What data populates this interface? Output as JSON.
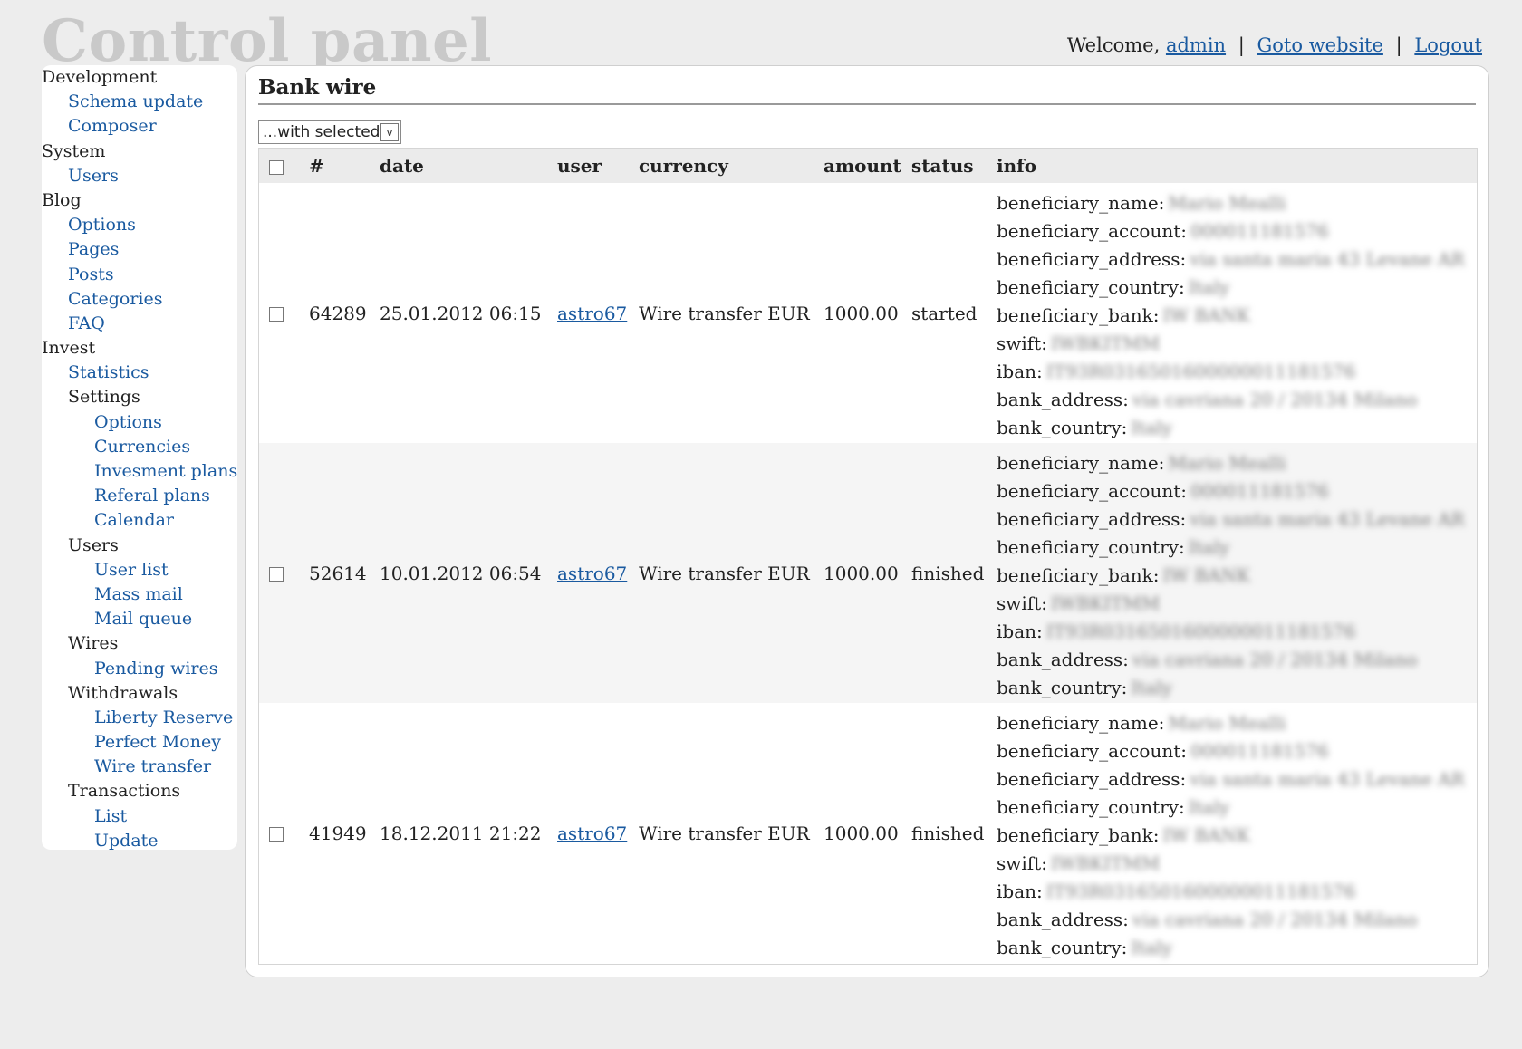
{
  "header": {
    "brand": "Control panel",
    "welcome": "Welcome,",
    "user_link": "admin",
    "goto_website": "Goto website",
    "logout": "Logout",
    "separator": "|"
  },
  "sidebar": {
    "groups": [
      {
        "label": "Development",
        "items": [
          {
            "label": "Schema update"
          },
          {
            "label": "Composer"
          }
        ]
      },
      {
        "label": "System",
        "items": [
          {
            "label": "Users"
          }
        ]
      },
      {
        "label": "Blog",
        "items": [
          {
            "label": "Options"
          },
          {
            "label": "Pages"
          },
          {
            "label": "Posts"
          },
          {
            "label": "Categories"
          },
          {
            "label": "FAQ"
          }
        ]
      },
      {
        "label": "Invest",
        "items": [
          {
            "label": "Statistics"
          }
        ],
        "subgroups": [
          {
            "label": "Settings",
            "items": [
              {
                "label": "Options"
              },
              {
                "label": "Currencies"
              },
              {
                "label": "Invesment plans"
              },
              {
                "label": "Referal plans"
              },
              {
                "label": "Calendar"
              }
            ]
          },
          {
            "label": "Users",
            "items": [
              {
                "label": "User list"
              },
              {
                "label": "Mass mail"
              },
              {
                "label": "Mail queue"
              }
            ]
          },
          {
            "label": "Wires",
            "items": [
              {
                "label": "Pending wires"
              }
            ]
          },
          {
            "label": "Withdrawals",
            "items": [
              {
                "label": "Liberty Reserve"
              },
              {
                "label": "Perfect Money"
              },
              {
                "label": "Wire transfer"
              }
            ]
          },
          {
            "label": "Transactions",
            "items": [
              {
                "label": "List"
              },
              {
                "label": "Update"
              }
            ]
          }
        ]
      }
    ]
  },
  "main": {
    "title": "Bank wire",
    "bulk_action": {
      "selected": "...with selected",
      "arrow": "v"
    },
    "table": {
      "columns": [
        "#",
        "date",
        "user",
        "currency",
        "amount",
        "status",
        "info"
      ],
      "rows": [
        {
          "id": "64289",
          "date": "25.01.2012 06:15",
          "user": "astro67",
          "currency": "Wire transfer EUR",
          "amount": "1000.00",
          "status": "started",
          "info": [
            {
              "key": "beneficiary_name:",
              "value": "Mario Mealli"
            },
            {
              "key": "beneficiary_account:",
              "value": "000011181576"
            },
            {
              "key": "beneficiary_address:",
              "value": "via santa maria 43 Levane AR"
            },
            {
              "key": "beneficiary_country:",
              "value": "Italy"
            },
            {
              "key": "beneficiary_bank:",
              "value": "IW BANK"
            },
            {
              "key": "swift:",
              "value": "IWBKITMM"
            },
            {
              "key": "iban:",
              "value": "IT93R0316501600000011181576"
            },
            {
              "key": "bank_address:",
              "value": "via cavriana 20 / 20134 Milano"
            },
            {
              "key": "bank_country:",
              "value": "Italy"
            }
          ]
        },
        {
          "id": "52614",
          "date": "10.01.2012 06:54",
          "user": "astro67",
          "currency": "Wire transfer EUR",
          "amount": "1000.00",
          "status": "finished",
          "info": [
            {
              "key": "beneficiary_name:",
              "value": "Mario Mealli"
            },
            {
              "key": "beneficiary_account:",
              "value": "000011181576"
            },
            {
              "key": "beneficiary_address:",
              "value": "via santa maria 43 Levane AR"
            },
            {
              "key": "beneficiary_country:",
              "value": "Italy"
            },
            {
              "key": "beneficiary_bank:",
              "value": "IW BANK"
            },
            {
              "key": "swift:",
              "value": "IWBKITMM"
            },
            {
              "key": "iban:",
              "value": "IT93R0316501600000011181576"
            },
            {
              "key": "bank_address:",
              "value": "via cavriana 20 / 20134 Milano"
            },
            {
              "key": "bank_country:",
              "value": "Italy"
            }
          ]
        },
        {
          "id": "41949",
          "date": "18.12.2011 21:22",
          "user": "astro67",
          "currency": "Wire transfer EUR",
          "amount": "1000.00",
          "status": "finished",
          "info": [
            {
              "key": "beneficiary_name:",
              "value": "Mario Mealli"
            },
            {
              "key": "beneficiary_account:",
              "value": "000011181576"
            },
            {
              "key": "beneficiary_address:",
              "value": "via santa maria 43 Levane AR"
            },
            {
              "key": "beneficiary_country:",
              "value": "Italy"
            },
            {
              "key": "beneficiary_bank:",
              "value": "IW BANK"
            },
            {
              "key": "swift:",
              "value": "IWBKITMM"
            },
            {
              "key": "iban:",
              "value": "IT93R0316501600000011181576"
            },
            {
              "key": "bank_address:",
              "value": "via cavriana 20 / 20134 Milano"
            },
            {
              "key": "bank_country:",
              "value": "Italy"
            }
          ]
        }
      ]
    }
  },
  "colors": {
    "page_bg": "#ededed",
    "brand_text": "#c9c9c9",
    "link": "#1a5aa0",
    "header_row_bg": "#ebebeb",
    "stripe_bg": "#f5f5f5"
  }
}
